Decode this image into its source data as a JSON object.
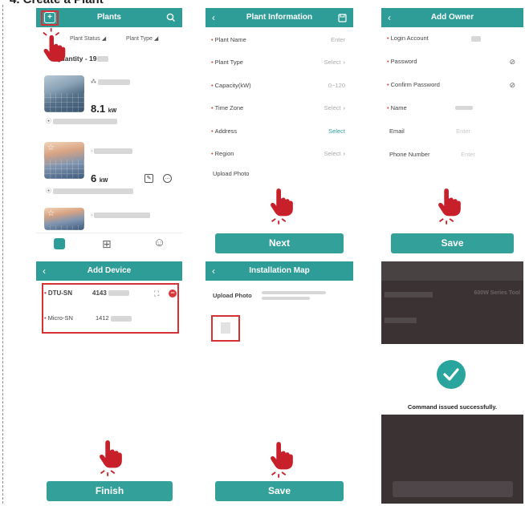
{
  "caption": "4. Create a Plant",
  "plants_screen": {
    "title": "Plants",
    "filter_status": "Plant Status",
    "filter_type": "Plant Type",
    "quantity_label": "Quantity - 19",
    "cards": [
      {
        "power_value": "8.1",
        "power_unit": "kW"
      },
      {
        "power_value": "6",
        "power_unit": "kW"
      },
      {
        "power_value": "",
        "power_unit": ""
      }
    ]
  },
  "plant_info_screen": {
    "title": "Plant Information",
    "fields": [
      {
        "label": "Plant Name",
        "value": "Enter",
        "required": true,
        "chevron": false,
        "teal": false
      },
      {
        "label": "Plant Type",
        "value": "Select",
        "required": true,
        "chevron": true,
        "teal": false
      },
      {
        "label": "Capacity(kW)",
        "value": "0~120",
        "required": true,
        "chevron": false,
        "teal": false
      },
      {
        "label": "Time Zone",
        "value": "Select",
        "required": true,
        "chevron": true,
        "teal": false
      },
      {
        "label": "Address",
        "value": "Select",
        "required": true,
        "chevron": false,
        "teal": true
      },
      {
        "label": "Region",
        "value": "Select",
        "required": true,
        "chevron": true,
        "teal": false
      }
    ],
    "upload_photo_label": "Upload Photo",
    "next_label": "Next"
  },
  "add_owner_screen": {
    "title": "Add Owner",
    "fields": [
      {
        "label": "Login Account",
        "required": true,
        "value": ""
      },
      {
        "label": "Password",
        "required": true,
        "value": ""
      },
      {
        "label": "Confirm Password",
        "required": true,
        "value": ""
      },
      {
        "label": "Name",
        "required": true,
        "value": ""
      },
      {
        "label": "Email",
        "required": false,
        "value": "Enter"
      },
      {
        "label": "Phone Number",
        "required": false,
        "value": "Enter"
      }
    ],
    "save_label": "Save"
  },
  "add_device_screen": {
    "title": "Add Device",
    "dtu_label": "DTU-SN",
    "dtu_value": "4143",
    "micro_label": "Micro-SN",
    "micro_value": "1412",
    "finish_label": "Finish"
  },
  "installation_map_screen": {
    "title": "Installation Map",
    "upload_photo_label": "Upload Photo",
    "save_label": "Save"
  },
  "success_screen": {
    "message": "Command issued successfully.",
    "background_series": "600W Series Tool"
  },
  "colors": {
    "teal": "#2e9d97",
    "red_highlight": "#d53236",
    "hand_red": "#c8202a",
    "success_green": "#29a59e",
    "dark_overlay": "#3b3234"
  }
}
